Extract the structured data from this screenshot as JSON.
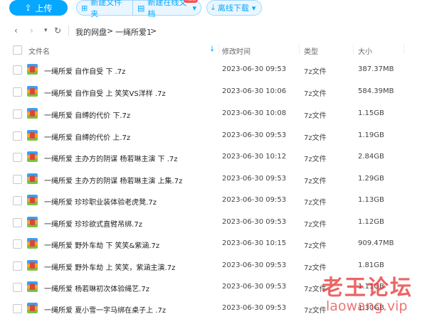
{
  "toolbar": {
    "upload_label": "上传",
    "new_folder_label": "新建文件夹",
    "new_doc_label": "新建在线文档",
    "new_doc_badge": "new",
    "offline_label": "离线下载"
  },
  "nav": {
    "breadcrumb": [
      "我的网盘",
      "一绳所爱1"
    ],
    "separator": ">"
  },
  "columns": {
    "name": "文件名",
    "modified": "修改时间",
    "type": "类型",
    "size": "大小"
  },
  "files": [
    {
      "name": "一绳所爱 自作自受 下 .7z",
      "modified": "2023-06-30 09:53",
      "type": "7z文件",
      "size": "387.37MB"
    },
    {
      "name": "一绳所爱 自作自受 上 笑笑VS洋样 .7z",
      "modified": "2023-06-30 10:06",
      "type": "7z文件",
      "size": "584.39MB"
    },
    {
      "name": "一绳所爱 自缚的代价 下.7z",
      "modified": "2023-06-30 10:08",
      "type": "7z文件",
      "size": "1.15GB"
    },
    {
      "name": "一绳所爱 自缚的代价 上.7z",
      "modified": "2023-06-30 09:53",
      "type": "7z文件",
      "size": "1.19GB"
    },
    {
      "name": "一绳所爱 主办方的阴谋 杨若琳主演 下 .7z",
      "modified": "2023-06-30 10:12",
      "type": "7z文件",
      "size": "2.84GB"
    },
    {
      "name": "一绳所爱 主办方的阴谋 杨若琳主演 上集.7z",
      "modified": "2023-06-30 09:53",
      "type": "7z文件",
      "size": "1.29GB"
    },
    {
      "name": "一绳所爱 珍珍职业装体验老虎凳.7z",
      "modified": "2023-06-30 09:53",
      "type": "7z文件",
      "size": "1.13GB"
    },
    {
      "name": "一绳所爱 珍珍欲式直臂吊绑.7z",
      "modified": "2023-06-30 09:53",
      "type": "7z文件",
      "size": "1.12GB"
    },
    {
      "name": "一绳所爱 野外车劫 下 笑笑&紫涵.7z",
      "modified": "2023-06-30 10:15",
      "type": "7z文件",
      "size": "909.47MB"
    },
    {
      "name": "一绳所爱 野外车劫 上 笑笑，紫涵主演.7z",
      "modified": "2023-06-30 09:53",
      "type": "7z文件",
      "size": "1.81GB"
    },
    {
      "name": "一绳所爱 杨若琳初次体验绳艺.7z",
      "modified": "2023-06-30 09:53",
      "type": "7z文件",
      "size": "1.11GB"
    },
    {
      "name": "一绳所爱 夏小雪一字马绑在桌子上 .7z",
      "modified": "2023-06-30 09:53",
      "type": "7z文件",
      "size": "1.30GB"
    }
  ],
  "watermark": {
    "title": "老王论坛",
    "url": "laowang.vip"
  }
}
